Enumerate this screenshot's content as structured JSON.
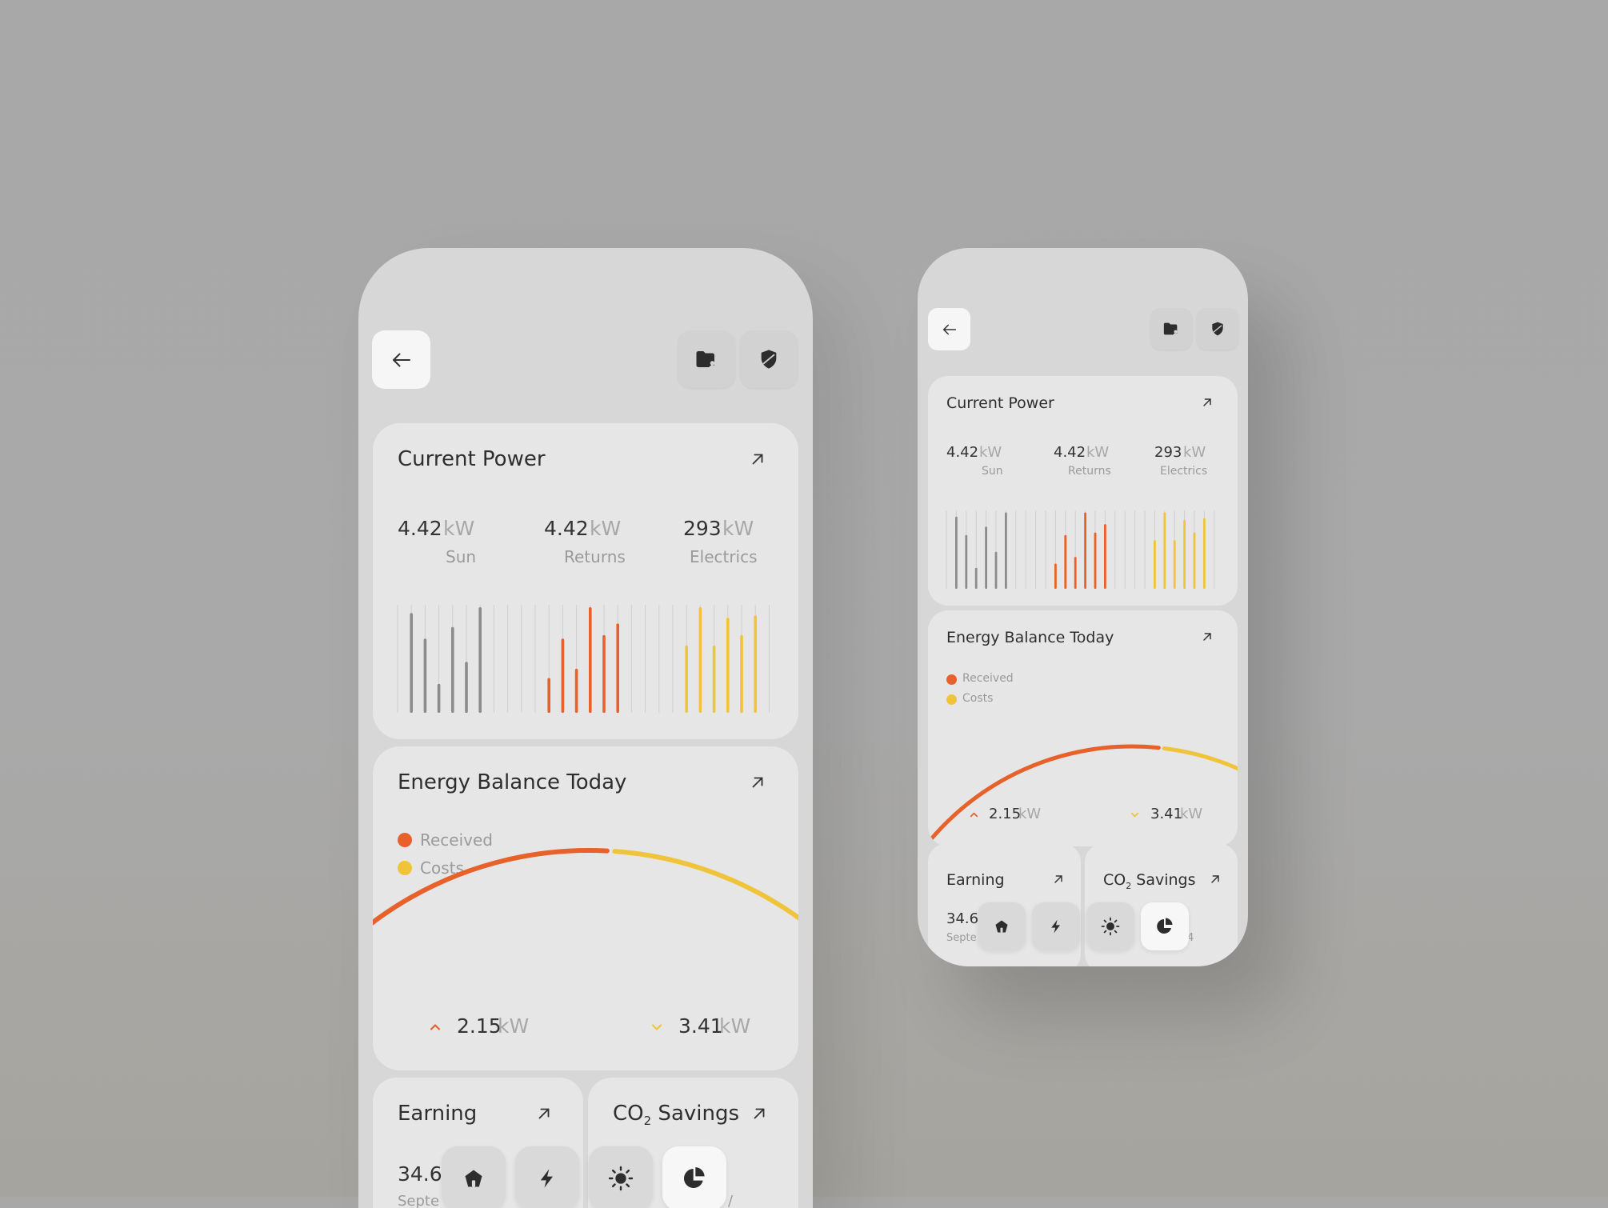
{
  "colors": {
    "background": "#a8a8a8",
    "phone": "#d7d7d7",
    "card": "#e6e6e6",
    "sun_bar": "#8c8c8c",
    "returns_bar": "#e8602a",
    "electrics_bar": "#f0c43a",
    "received": "#e8602a",
    "costs": "#f0c43a",
    "remaining": "#c4c4c4"
  },
  "header": {
    "back_icon": "arrow-left-icon",
    "actions": [
      "folder-user-icon",
      "shield-icon"
    ]
  },
  "current_power": {
    "title": "Current Power",
    "open_icon": "arrow-up-right-icon",
    "stats": [
      {
        "value": "4.42",
        "unit": "kW",
        "label": "Sun"
      },
      {
        "value": "4.42",
        "unit": "kW",
        "label": "Returns"
      },
      {
        "value": "293",
        "unit": "kW",
        "label": "Electrics"
      }
    ]
  },
  "chart_data": {
    "type": "bar",
    "series": [
      {
        "name": "Sun",
        "values": [
          0.86,
          0.64,
          0.25,
          0.74,
          0.44,
          0.91
        ]
      },
      {
        "name": "Returns",
        "values": [
          0.3,
          0.64,
          0.38,
          0.91,
          0.67,
          0.77
        ]
      },
      {
        "name": "Electrics",
        "values": [
          0.58,
          0.91,
          0.58,
          0.82,
          0.67,
          0.84
        ]
      }
    ]
  },
  "energy_balance": {
    "title": "Energy Balance Today",
    "open_icon": "arrow-up-right-icon",
    "legend": [
      {
        "label": "Received",
        "color": "#e8602a"
      },
      {
        "label": "Costs",
        "color": "#f0c43a"
      }
    ],
    "arc_shares": {
      "received": 0.56,
      "costs": 0.34,
      "remaining": 0.1
    },
    "received": {
      "value": "2.15",
      "unit": "kW"
    },
    "costs": {
      "value": "3.41",
      "unit": "kW"
    }
  },
  "earning": {
    "title": "Earning",
    "value_partial": "34.6",
    "sub_partial_large": "Septe",
    "sub_partial_small": "Septe"
  },
  "co2": {
    "title_prefix": "CO",
    "title_sub": "2",
    "title_suffix": " Savings",
    "sub_partial_large": "/",
    "sub_partial_small": "4"
  },
  "bottom_nav": [
    {
      "icon": "home-icon",
      "active": false
    },
    {
      "icon": "bolt-icon",
      "active": false
    },
    {
      "icon": "sun-icon",
      "active": false
    },
    {
      "icon": "pie-chart-icon",
      "active": true
    }
  ]
}
